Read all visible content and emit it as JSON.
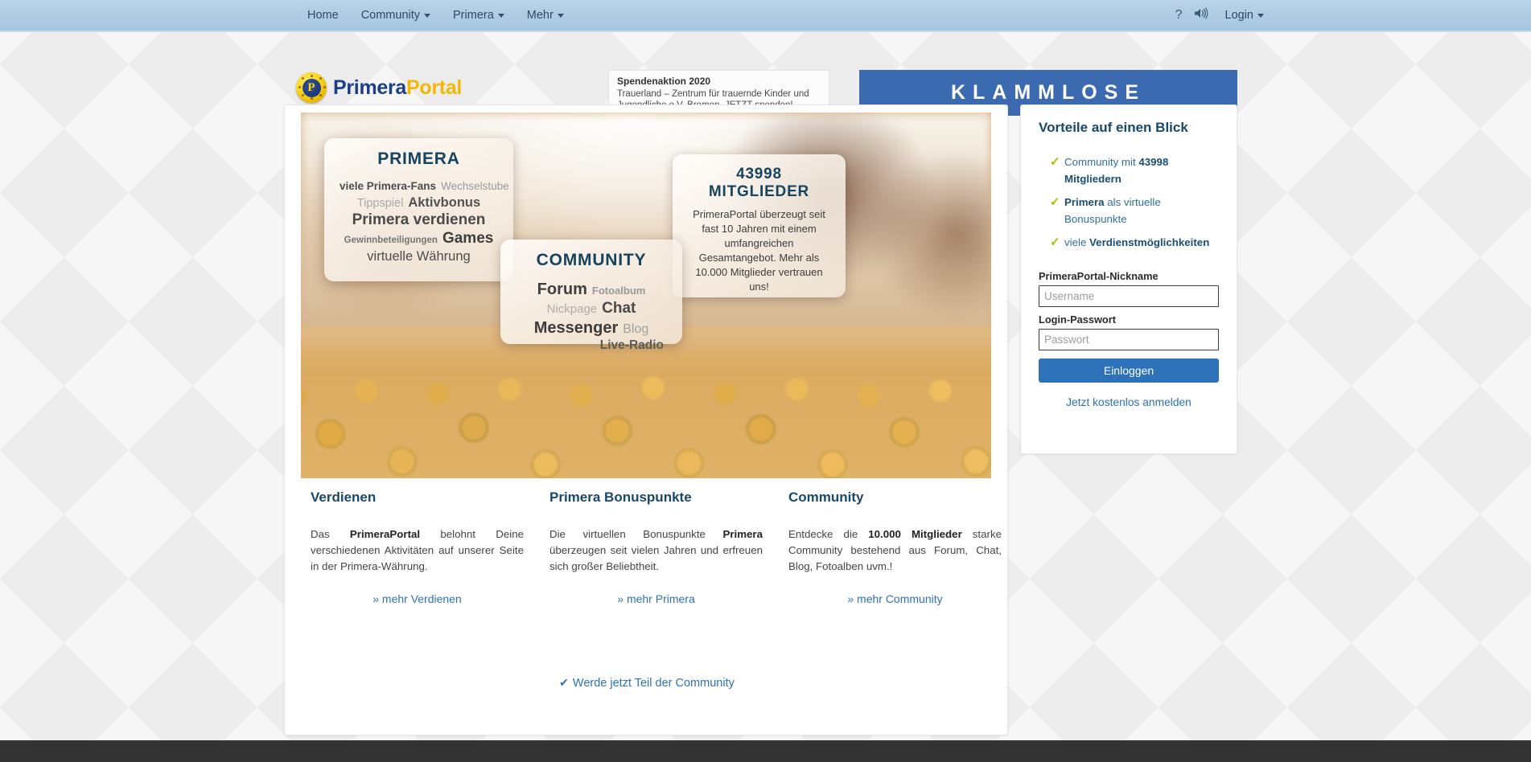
{
  "topnav": {
    "items": [
      {
        "label": "Home",
        "dropdown": false
      },
      {
        "label": "Community",
        "dropdown": true
      },
      {
        "label": "Primera",
        "dropdown": true
      },
      {
        "label": "Mehr",
        "dropdown": true
      }
    ],
    "help_icon": "?",
    "sound_icon": "speaker-icon",
    "login": "Login"
  },
  "header": {
    "logo_coin_letter": "P",
    "logo_part1": "Primera",
    "logo_part2": "Portal",
    "breadcrumb": "PrimeraPortal »",
    "donation": {
      "title": "Spendenaktion 2020",
      "text": "Trauerland – Zentrum für trauernde Kinder und Jugendliche e.V. Bremen. JETZT spenden!"
    },
    "banner": "KLAMMLOSE"
  },
  "hero": {
    "primera": {
      "title": "PRIMERA",
      "words": [
        "viele Primera-Fans",
        "Wechselstube",
        "Tippspiel",
        "Aktivbonus",
        "Primera verdienen",
        "Gewinnbeteiligungen",
        "Games",
        "virtuelle Währung"
      ]
    },
    "community": {
      "title": "COMMUNITY",
      "words": [
        "Forum",
        "Fotoalbum",
        "Nickpage",
        "Chat",
        "Messenger",
        "Blog",
        "Live-Radio"
      ]
    },
    "members": {
      "title": "43998 MITGLIEDER",
      "text": "PrimeraPortal überzeugt seit fast 10 Jahren mit einem umfangreichen Gesamtangebot. Mehr als 10.000 Mitglieder vertrauen uns!"
    }
  },
  "columns": [
    {
      "heading": "Verdienen",
      "text_before": "Das ",
      "text_bold": "PrimeraPortal",
      "text_after": " belohnt Deine verschiedenen Aktivitäten auf unserer Seite in der Primera-Währung.",
      "link": "» mehr Verdienen"
    },
    {
      "heading": "Primera Bonuspunkte",
      "text_before": "Die virtuellen Bonuspunkte ",
      "text_bold": "Primera",
      "text_after": " überzeugen seit vielen Jahren und erfreuen sich großer Beliebtheit.",
      "link": "» mehr Primera"
    },
    {
      "heading": "Community",
      "text_before": "Entdecke die ",
      "text_bold": "10.000 Mitglieder",
      "text_after": " starke Community bestehend aus Forum, Chat, Blog, Fotoalben uvm.!",
      "link": "» mehr Community"
    }
  ],
  "cta": {
    "icon": "check-icon",
    "label": "Werde jetzt Teil der Community"
  },
  "sidebar": {
    "title": "Vorteile auf einen Blick",
    "advantages": [
      {
        "pre": "Community mit ",
        "strong": "43998 Mitgliedern",
        "post": ""
      },
      {
        "pre": "",
        "strong": "Primera",
        "post": " als virtuelle Bonuspunkte"
      },
      {
        "pre": "viele ",
        "strong": "Verdienstmöglichkeiten",
        "post": ""
      }
    ],
    "nickname_label": "PrimeraPortal-Nickname",
    "nickname_value": "",
    "nickname_placeholder": "Username",
    "password_label": "Login-Passwort",
    "password_value": "",
    "password_placeholder": "Passwort",
    "login_button": "Einloggen",
    "signup_link": "Jetzt kostenlos anmelden"
  },
  "colors": {
    "nav_bg": "#aecbe2",
    "brand_blue": "#1b3e86",
    "brand_yellow": "#f2b705",
    "accent_blue": "#2d72b8",
    "banner_blue": "#3c6ab0",
    "heading_blue": "#18496b",
    "tick_green": "#a8c000",
    "footer": "#333333"
  }
}
